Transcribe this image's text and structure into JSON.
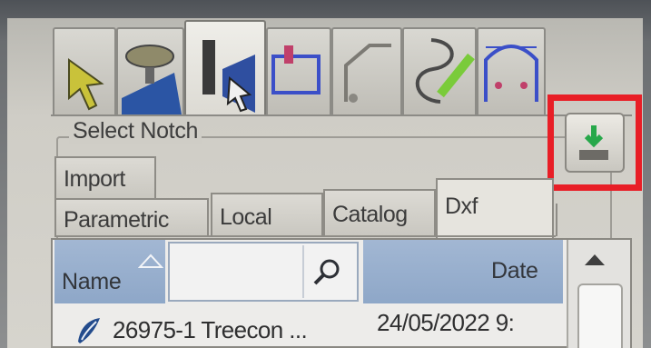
{
  "group": {
    "title": "Select Notch"
  },
  "tool_tabs": [
    {
      "icon": "cursor-arrow-icon"
    },
    {
      "icon": "machine-cut-icon"
    },
    {
      "icon": "notch-tool-icon"
    },
    {
      "icon": "rectangle-notch-icon"
    },
    {
      "icon": "chamfer-corner-icon"
    },
    {
      "icon": "freehand-curve-icon"
    },
    {
      "icon": "arch-profile-icon"
    }
  ],
  "tabs": {
    "import": "Import",
    "parametric": "Parametric",
    "local": "Local",
    "catalog": "Catalog",
    "dxf": "Dxf"
  },
  "action_button": {
    "icon": "import-dxf-icon"
  },
  "list": {
    "columns": {
      "name": "Name",
      "date": "Date"
    },
    "filter_value": "",
    "rows": [
      {
        "name": "26975-1 Treecon ...",
        "date": "24/05/2022 9:",
        "icon": "dxf-file-icon"
      }
    ]
  },
  "colors": {
    "highlight": "#e81e26",
    "header": "#9bb0ce"
  }
}
